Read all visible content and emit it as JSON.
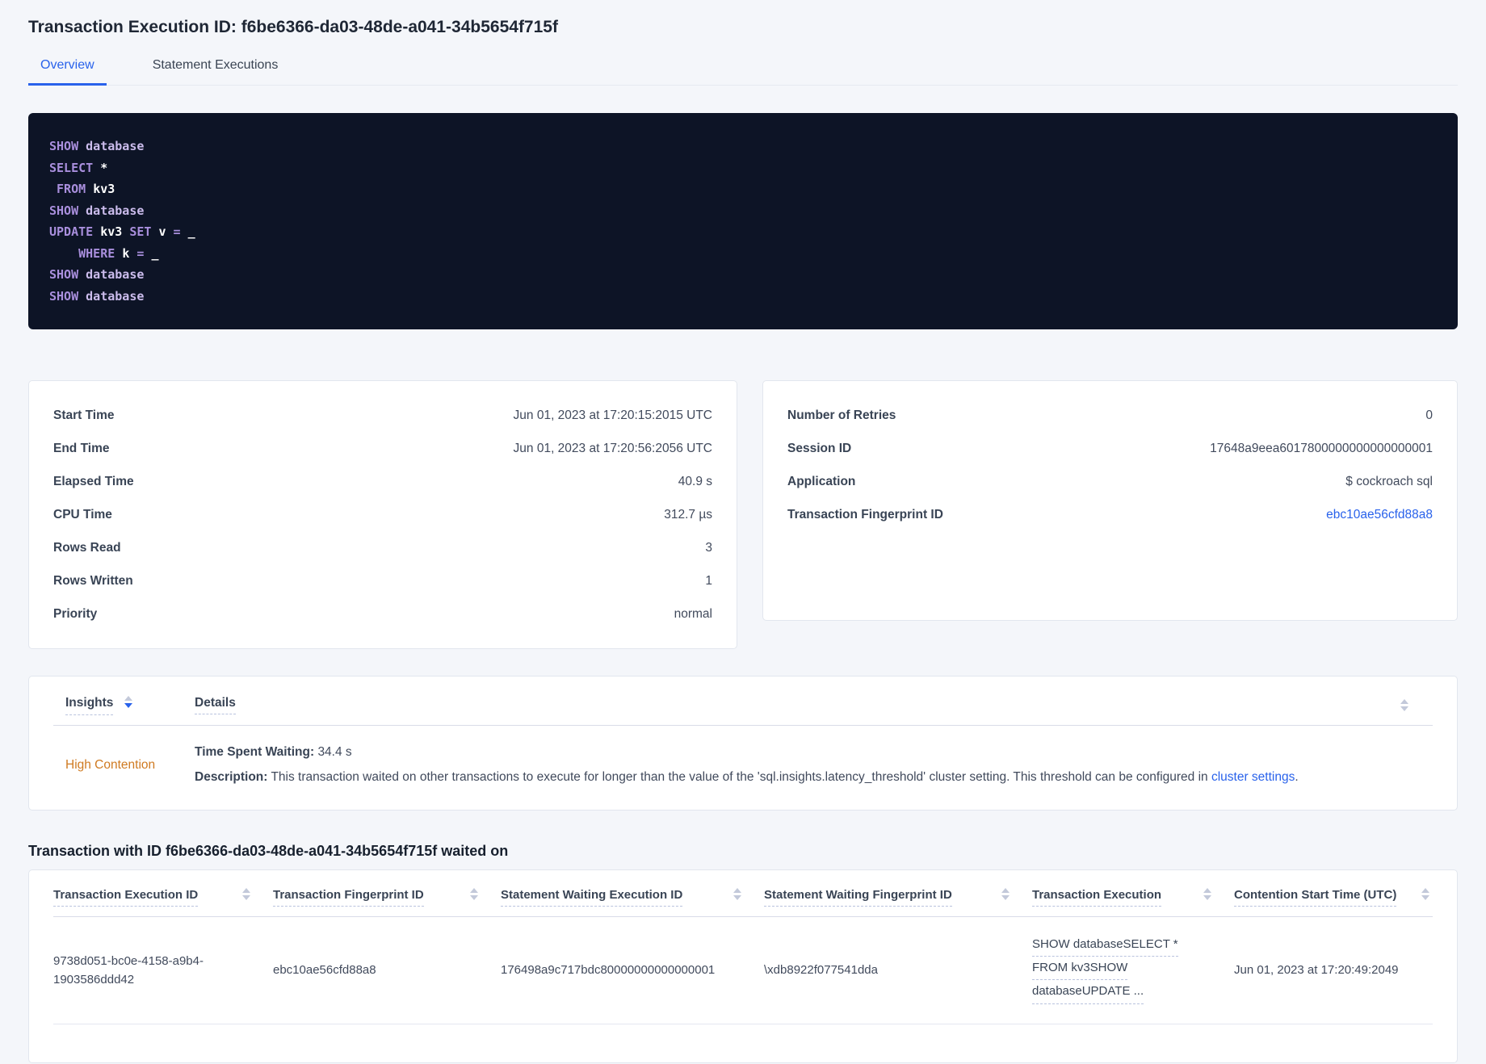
{
  "header": {
    "title": "Transaction Execution ID: f6be6366-da03-48de-a041-34b5654f715f"
  },
  "tabs": [
    {
      "label": "Overview",
      "active": true
    },
    {
      "label": "Statement Executions",
      "active": false
    }
  ],
  "sql": {
    "lines": [
      [
        {
          "t": "SHOW ",
          "c": "k"
        },
        {
          "t": "database",
          "c": "d"
        }
      ],
      [
        {
          "t": "SELECT ",
          "c": "k"
        },
        {
          "t": "*",
          "c": "p"
        }
      ],
      [
        {
          "t": " ",
          "c": "p"
        },
        {
          "t": "FROM ",
          "c": "k"
        },
        {
          "t": "kv3",
          "c": "p"
        }
      ],
      [
        {
          "t": "SHOW ",
          "c": "k"
        },
        {
          "t": "database",
          "c": "d"
        }
      ],
      [
        {
          "t": "UPDATE ",
          "c": "k"
        },
        {
          "t": "kv3 ",
          "c": "p"
        },
        {
          "t": "SET ",
          "c": "k"
        },
        {
          "t": "v ",
          "c": "p"
        },
        {
          "t": "= ",
          "c": "k"
        },
        {
          "t": "_",
          "c": "p"
        }
      ],
      [
        {
          "t": "    ",
          "c": "p"
        },
        {
          "t": "WHERE ",
          "c": "k"
        },
        {
          "t": "k ",
          "c": "p"
        },
        {
          "t": "= ",
          "c": "k"
        },
        {
          "t": "_",
          "c": "p"
        }
      ],
      [
        {
          "t": "SHOW ",
          "c": "k"
        },
        {
          "t": "database",
          "c": "d"
        }
      ],
      [
        {
          "t": "SHOW ",
          "c": "k"
        },
        {
          "t": "database",
          "c": "d"
        }
      ]
    ]
  },
  "summary_left": {
    "rows": [
      {
        "label": "Start Time",
        "value": "Jun 01, 2023 at 17:20:15:2015 UTC"
      },
      {
        "label": "End Time",
        "value": "Jun 01, 2023 at 17:20:56:2056 UTC"
      },
      {
        "label": "Elapsed Time",
        "value": "40.9 s"
      },
      {
        "label": "CPU Time",
        "value": "312.7 µs"
      },
      {
        "label": "Rows Read",
        "value": "3"
      },
      {
        "label": "Rows Written",
        "value": "1"
      },
      {
        "label": "Priority",
        "value": "normal"
      }
    ]
  },
  "summary_right": {
    "rows": [
      {
        "label": "Number of Retries",
        "value": "0"
      },
      {
        "label": "Session ID",
        "value": "17648a9eea6017800000000000000001"
      },
      {
        "label": "Application",
        "value": "$ cockroach sql"
      },
      {
        "label": "Transaction Fingerprint ID",
        "value": "ebc10ae56cfd88a8",
        "link": true
      }
    ]
  },
  "insights": {
    "columns": [
      "Insights",
      "Details"
    ],
    "row": {
      "insight": "High Contention",
      "waiting_label": "Time Spent Waiting:",
      "waiting_value": "34.4 s",
      "description_label": "Description:",
      "description_text": "This transaction waited on other transactions to execute for longer than the value of the 'sql.insights.latency_threshold' cluster setting. This threshold can be configured in ",
      "description_link": "cluster settings",
      "description_suffix": "."
    }
  },
  "waited": {
    "heading": "Transaction with ID f6be6366-da03-48de-a041-34b5654f715f waited on",
    "columns": [
      "Transaction Execution ID",
      "Transaction Fingerprint ID",
      "Statement Waiting Execution ID",
      "Statement Waiting Fingerprint ID",
      "Transaction Execution",
      "Contention Start Time (UTC)"
    ],
    "row": {
      "transaction_execution_id": "9738d051-bc0e-4158-a9b4-1903586ddd42",
      "transaction_fingerprint_id": "ebc10ae56cfd88a8",
      "statement_waiting_execution_id": "176498a9c717bdc80000000000000001",
      "statement_waiting_fingerprint_id": "\\xdb8922f077541dda",
      "transaction_execution_lines": [
        "SHOW databaseSELECT *",
        "FROM kv3SHOW",
        "databaseUPDATE ..."
      ],
      "contention_start_time": "Jun 01, 2023 at 17:20:49:2049"
    }
  },
  "colors": {
    "accent_blue": "#2962eb",
    "orange": "#cf7a21",
    "code_bg": "#0d1426",
    "code_keyword": "#a98fdd",
    "code_secondary": "#cbbcec",
    "code_plain": "#ffffff"
  }
}
